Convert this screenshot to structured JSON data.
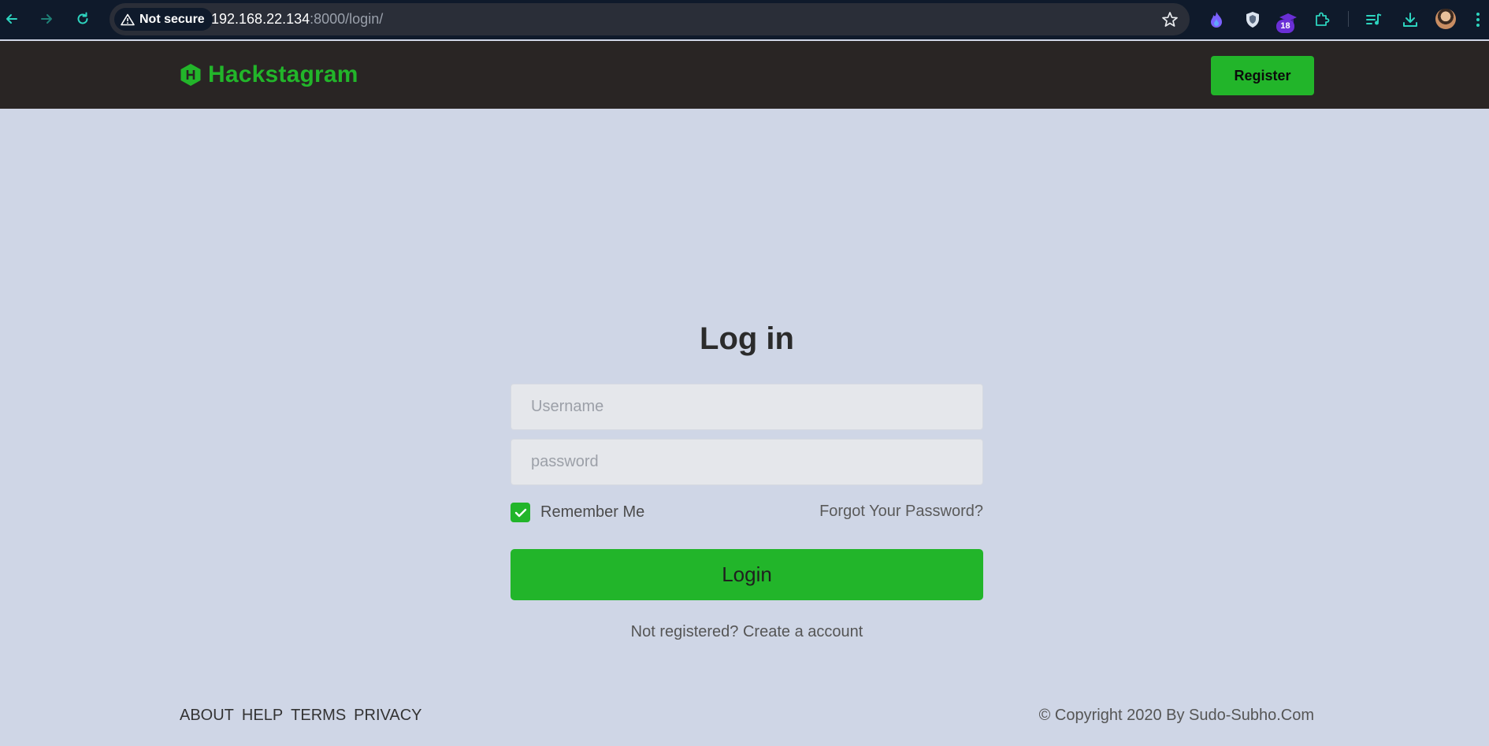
{
  "browser": {
    "security_label": "Not secure",
    "url_host": "192.168.22.134",
    "url_rest": ":8000/login/",
    "extension_badge": "18"
  },
  "header": {
    "brand": "Hackstagram",
    "register_label": "Register"
  },
  "login": {
    "title": "Log in",
    "username_placeholder": "Username",
    "password_placeholder": "password",
    "remember_label": "Remember Me",
    "remember_checked": true,
    "forgot_label": "Forgot Your Password?",
    "submit_label": "Login",
    "not_registered_text": "Not registered?",
    "create_account_label": "Create a account"
  },
  "footer": {
    "links": [
      "ABOUT",
      "HELP",
      "TERMS",
      "PRIVACY"
    ],
    "copyright": "© Copyright 2020 By Sudo-Subho.Com"
  },
  "colors": {
    "accent": "#22b52a",
    "header_bg": "#292524",
    "page_bg": "#cfd6e6",
    "chrome_bg": "#0f1a2b"
  }
}
